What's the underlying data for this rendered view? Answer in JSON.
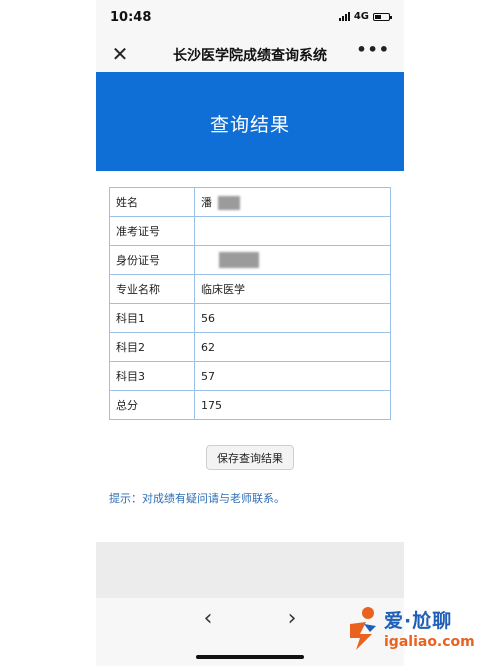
{
  "status_bar": {
    "time": "10:48",
    "network": "4G"
  },
  "nav": {
    "title": "长沙医学院成绩查询系统",
    "close": "✕",
    "more": "•••"
  },
  "banner": {
    "title": "查询结果"
  },
  "rows": [
    {
      "label": "姓名",
      "value": "潘"
    },
    {
      "label": "准考证号",
      "value": ""
    },
    {
      "label": "身份证号",
      "value": ""
    },
    {
      "label": "专业名称",
      "value": "临床医学"
    },
    {
      "label": "科目1",
      "value": "56"
    },
    {
      "label": "科目2",
      "value": "62"
    },
    {
      "label": "科目3",
      "value": "57"
    },
    {
      "label": "总分",
      "value": "175"
    }
  ],
  "save_button": "保存查询结果",
  "hint": "提示：对成绩有疑问请与老师联系。",
  "browser_nav": {
    "back": "‹",
    "forward": "›"
  },
  "watermark": {
    "line1": "爱·尬聊",
    "line2": "igaliao.com"
  },
  "colors": {
    "banner": "#0f6fd6",
    "table_border": "#9cc0e8",
    "hint": "#2f6fb5"
  }
}
